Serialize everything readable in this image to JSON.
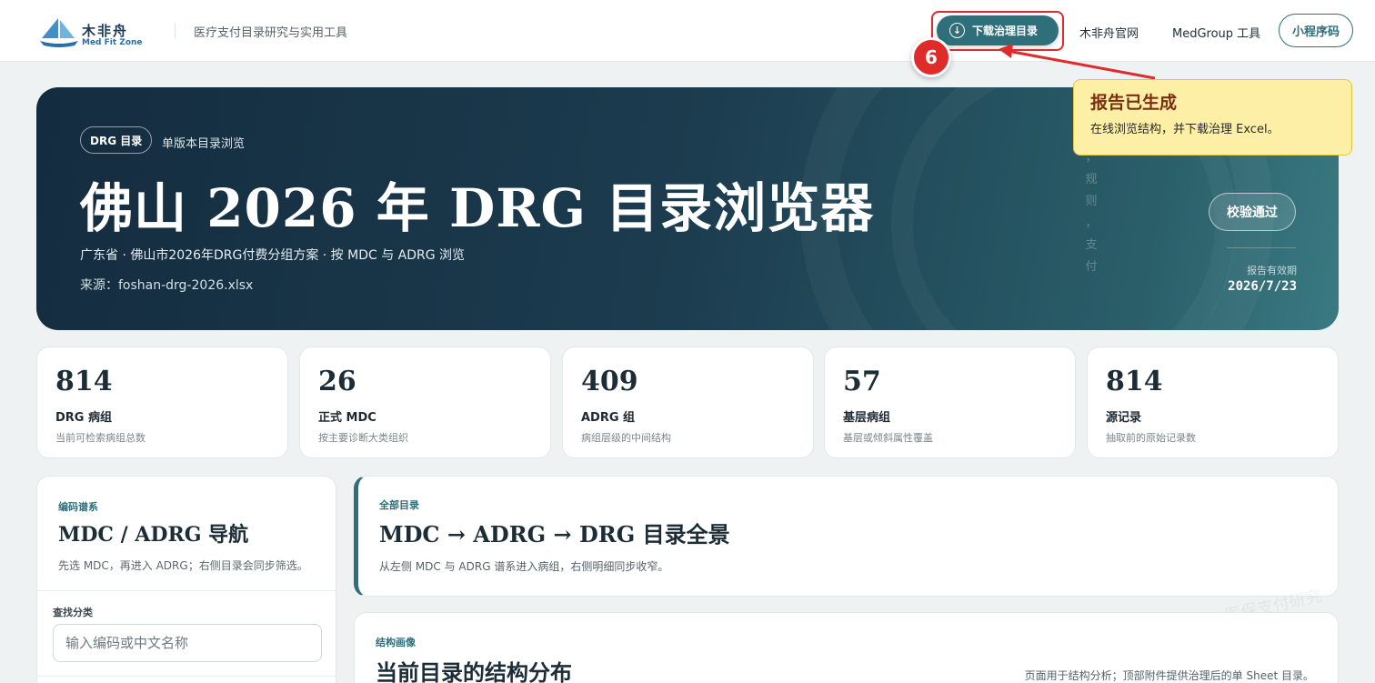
{
  "brand": {
    "name_cn": "木非舟",
    "name_en": "Med Fit Zone",
    "tagline": "医疗支付目录研究与实用工具"
  },
  "nav": {
    "download_label": "下载治理目录",
    "official_site": "木非舟官网",
    "medgroup_tools": "MedGroup 工具",
    "mini_program": "小程序码"
  },
  "annotation": {
    "step": "6",
    "title": "报告已生成",
    "text": "在线浏览结构，并下载治理 Excel。"
  },
  "hero": {
    "pill": "DRG 目录",
    "subtitle": "单版本目录浏览",
    "title": "佛山 2026 年 DRG 目录浏览器",
    "description": "广东省 · 佛山市2026年DRG付费分组方案 · 按 MDC 与 ADRG 浏览",
    "source": "来源：foshan-drg-2026.xlsx",
    "vertical_text": [
      "，",
      "规",
      "则",
      "，",
      "支",
      "付"
    ],
    "verify_label": "校验通过",
    "valid_label": "报告有效期",
    "valid_date": "2026/7/23"
  },
  "stats": [
    {
      "value": "814",
      "label": "DRG 病组",
      "desc": "当前可检索病组总数"
    },
    {
      "value": "26",
      "label": "正式 MDC",
      "desc": "按主要诊断大类组织"
    },
    {
      "value": "409",
      "label": "ADRG 组",
      "desc": "病组层级的中间结构"
    },
    {
      "value": "57",
      "label": "基层病组",
      "desc": "基层或倾斜属性覆盖"
    },
    {
      "value": "814",
      "label": "源记录",
      "desc": "抽取前的原始记录数"
    }
  ],
  "sidebar": {
    "kicker": "编码谱系",
    "title": "MDC / ADRG 导航",
    "hint": "先选 MDC，再进入 ADRG；右侧目录会同步筛选。",
    "find_label": "查找分类",
    "search_placeholder": "输入编码或中文名称"
  },
  "overview": {
    "kicker": "全部目录",
    "title": "MDC → ADRG → DRG 目录全景",
    "description": "从左侧 MDC 与 ADRG 谱系进入病组，右侧明细同步收窄。"
  },
  "structure": {
    "kicker": "结构画像",
    "title": "当前目录的结构分布",
    "note": "页面用于结构分析；顶部附件提供治理后的单 Sheet 目录。"
  },
  "watermark": "医保支付研究",
  "colors": {
    "accent": "#2f6f7b",
    "annotation_red": "#e02b2b",
    "callout_bg": "#fdf0a6",
    "hero_dark": "#142c3f"
  }
}
